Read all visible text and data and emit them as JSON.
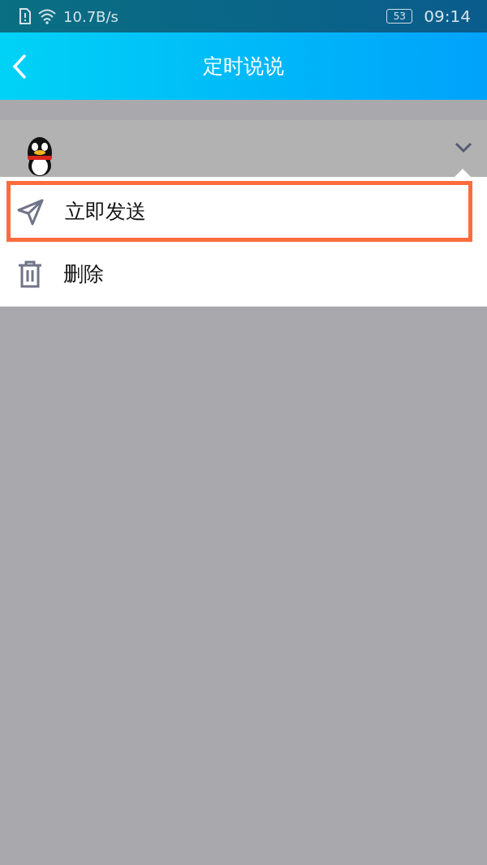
{
  "status_bar": {
    "network_speed": "10.7B/s",
    "battery": "53",
    "time": "09:14"
  },
  "header": {
    "title": "定时说说"
  },
  "menu": {
    "items": [
      {
        "kind": "send",
        "label": "立即发送",
        "highlighted": true
      },
      {
        "kind": "delete",
        "label": "删除",
        "highlighted": false
      }
    ]
  }
}
